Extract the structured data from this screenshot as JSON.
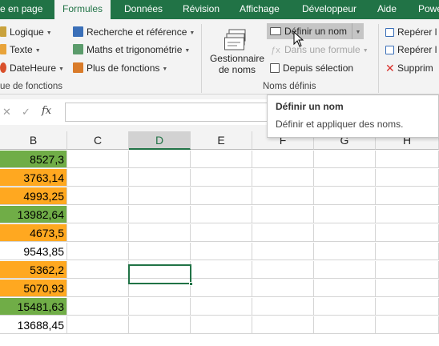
{
  "tabs": [
    "e en page",
    "Formules",
    "Données",
    "Révision",
    "Affichage",
    "Développeur",
    "Aide",
    "Powe"
  ],
  "ribbon": {
    "library": {
      "logique": "Logique",
      "texte": "Texte",
      "dateheure": "DateHeure",
      "recherche": "Recherche et référence",
      "maths": "Maths et trigonométrie",
      "plus": "Plus de fonctions",
      "group_label": "ue de fonctions"
    },
    "defined_names": {
      "gestionnaire_line1": "Gestionnaire",
      "gestionnaire_line2": "de noms",
      "definir": "Définir un nom",
      "dans_formule": "Dans une formule",
      "depuis_selection": "Depuis sélection",
      "group_label": "Noms définis"
    },
    "audit": {
      "reperer1": "Repérer l",
      "reperer2": "Repérer l",
      "supprimer": "Supprim"
    }
  },
  "formula_bar": {
    "fx": "fx"
  },
  "tooltip": {
    "title": "Définir un nom",
    "description": "Définir et appliquer des noms."
  },
  "columns": [
    "B",
    "C",
    "D",
    "E",
    "F",
    "G",
    "H"
  ],
  "selected_column": "D",
  "column_b_values": [
    "8527,3",
    "3763,14",
    "4993,25",
    "13982,64",
    "4673,5",
    "9543,85",
    "5362,2",
    "5070,93",
    "15481,63",
    "13688,45"
  ],
  "column_b_fills": [
    "green",
    "orange",
    "orange",
    "green",
    "orange",
    "none",
    "orange",
    "orange",
    "green",
    "none"
  ],
  "colors": {
    "accent_green": "#217346",
    "fill_green": "#70ad47",
    "fill_orange": "#ffa820"
  }
}
